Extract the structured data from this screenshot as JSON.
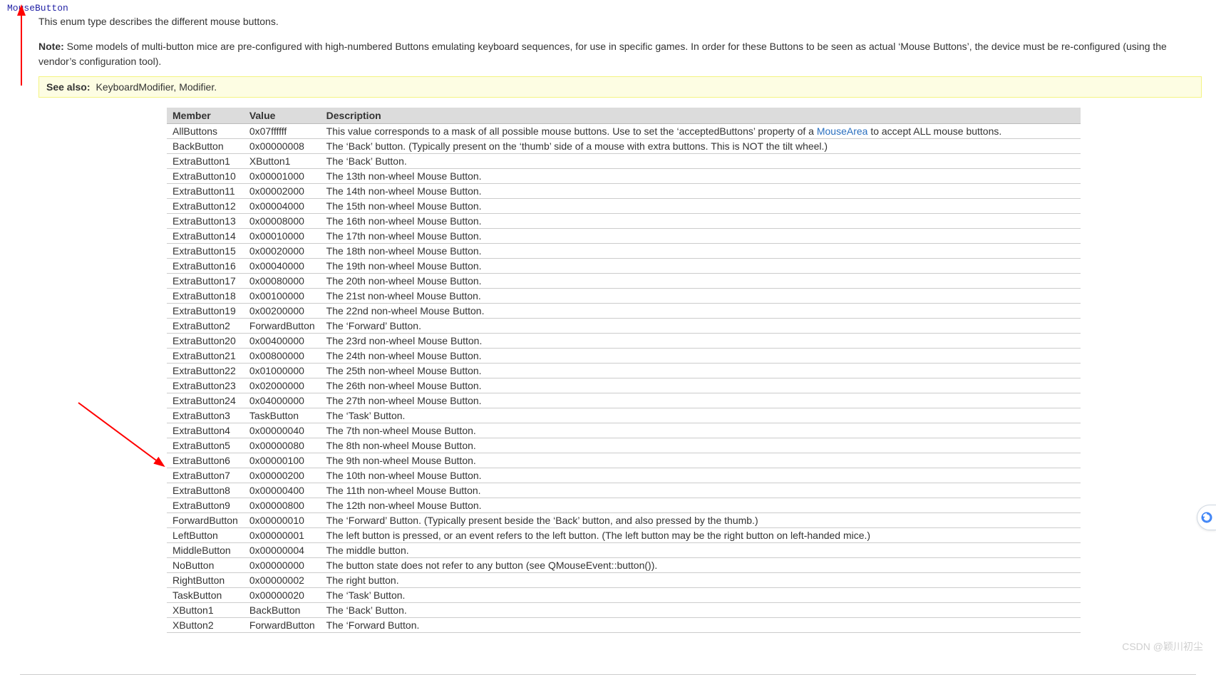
{
  "title": "MouseButton",
  "intro": "This enum type describes the different mouse buttons.",
  "note_label": "Note:",
  "note_text": " Some models of multi-button mice are pre-configured with high-numbered Buttons emulating keyboard sequences, for use in specific games. In order for these Buttons to be seen as actual ‘Mouse Buttons’, the device must be re-configured (using the vendor’s configuration tool).",
  "see_also_label": "See also:",
  "see_also_links": "KeyboardModifier, Modifier.",
  "headers": {
    "member": "Member",
    "value": "Value",
    "description": "Description"
  },
  "link_text": "MouseArea",
  "rows": [
    {
      "member": "AllButtons",
      "value": "0x07ffffff",
      "desc_pre": "This value corresponds to a mask of all possible mouse buttons. Use to set the ‘acceptedButtons’ property of a ",
      "desc_post": " to accept ALL mouse buttons.",
      "has_link": true
    },
    {
      "member": "BackButton",
      "value": "0x00000008",
      "desc": "The ‘Back’ button. (Typically present on the ‘thumb’ side of a mouse with extra buttons. This is NOT the tilt wheel.)"
    },
    {
      "member": "ExtraButton1",
      "value": "XButton1",
      "desc": "The ‘Back’ Button."
    },
    {
      "member": "ExtraButton10",
      "value": "0x00001000",
      "desc": "The 13th non-wheel Mouse Button."
    },
    {
      "member": "ExtraButton11",
      "value": "0x00002000",
      "desc": "The 14th non-wheel Mouse Button."
    },
    {
      "member": "ExtraButton12",
      "value": "0x00004000",
      "desc": "The 15th non-wheel Mouse Button."
    },
    {
      "member": "ExtraButton13",
      "value": "0x00008000",
      "desc": "The 16th non-wheel Mouse Button."
    },
    {
      "member": "ExtraButton14",
      "value": "0x00010000",
      "desc": "The 17th non-wheel Mouse Button."
    },
    {
      "member": "ExtraButton15",
      "value": "0x00020000",
      "desc": "The 18th non-wheel Mouse Button."
    },
    {
      "member": "ExtraButton16",
      "value": "0x00040000",
      "desc": "The 19th non-wheel Mouse Button."
    },
    {
      "member": "ExtraButton17",
      "value": "0x00080000",
      "desc": "The 20th non-wheel Mouse Button."
    },
    {
      "member": "ExtraButton18",
      "value": "0x00100000",
      "desc": "The 21st non-wheel Mouse Button."
    },
    {
      "member": "ExtraButton19",
      "value": "0x00200000",
      "desc": "The 22nd non-wheel Mouse Button."
    },
    {
      "member": "ExtraButton2",
      "value": "ForwardButton",
      "desc": "The ‘Forward’ Button."
    },
    {
      "member": "ExtraButton20",
      "value": "0x00400000",
      "desc": "The 23rd non-wheel Mouse Button."
    },
    {
      "member": "ExtraButton21",
      "value": "0x00800000",
      "desc": "The 24th non-wheel Mouse Button."
    },
    {
      "member": "ExtraButton22",
      "value": "0x01000000",
      "desc": "The 25th non-wheel Mouse Button."
    },
    {
      "member": "ExtraButton23",
      "value": "0x02000000",
      "desc": "The 26th non-wheel Mouse Button."
    },
    {
      "member": "ExtraButton24",
      "value": "0x04000000",
      "desc": "The 27th non-wheel Mouse Button."
    },
    {
      "member": "ExtraButton3",
      "value": "TaskButton",
      "desc": "The ‘Task’ Button."
    },
    {
      "member": "ExtraButton4",
      "value": "0x00000040",
      "desc": "The 7th non-wheel Mouse Button."
    },
    {
      "member": "ExtraButton5",
      "value": "0x00000080",
      "desc": "The 8th non-wheel Mouse Button."
    },
    {
      "member": "ExtraButton6",
      "value": "0x00000100",
      "desc": "The 9th non-wheel Mouse Button."
    },
    {
      "member": "ExtraButton7",
      "value": "0x00000200",
      "desc": "The 10th non-wheel Mouse Button."
    },
    {
      "member": "ExtraButton8",
      "value": "0x00000400",
      "desc": "The 11th non-wheel Mouse Button."
    },
    {
      "member": "ExtraButton9",
      "value": "0x00000800",
      "desc": "The 12th non-wheel Mouse Button."
    },
    {
      "member": "ForwardButton",
      "value": "0x00000010",
      "desc": "The ‘Forward’ Button. (Typically present beside the ‘Back’ button, and also pressed by the thumb.)"
    },
    {
      "member": "LeftButton",
      "value": "0x00000001",
      "desc": "The left button is pressed, or an event refers to the left button. (The left button may be the right button on left-handed mice.)"
    },
    {
      "member": "MiddleButton",
      "value": "0x00000004",
      "desc": "The middle button."
    },
    {
      "member": "NoButton",
      "value": "0x00000000",
      "desc": "The button state does not refer to any button (see QMouseEvent::button())."
    },
    {
      "member": "RightButton",
      "value": "0x00000002",
      "desc": "The right button."
    },
    {
      "member": "TaskButton",
      "value": "0x00000020",
      "desc": "The ‘Task’ Button."
    },
    {
      "member": "XButton1",
      "value": "BackButton",
      "desc": "The ‘Back’ Button."
    },
    {
      "member": "XButton2",
      "value": "ForwardButton",
      "desc": "The ‘Forward Button."
    }
  ],
  "watermark": "CSDN @颖川初尘"
}
